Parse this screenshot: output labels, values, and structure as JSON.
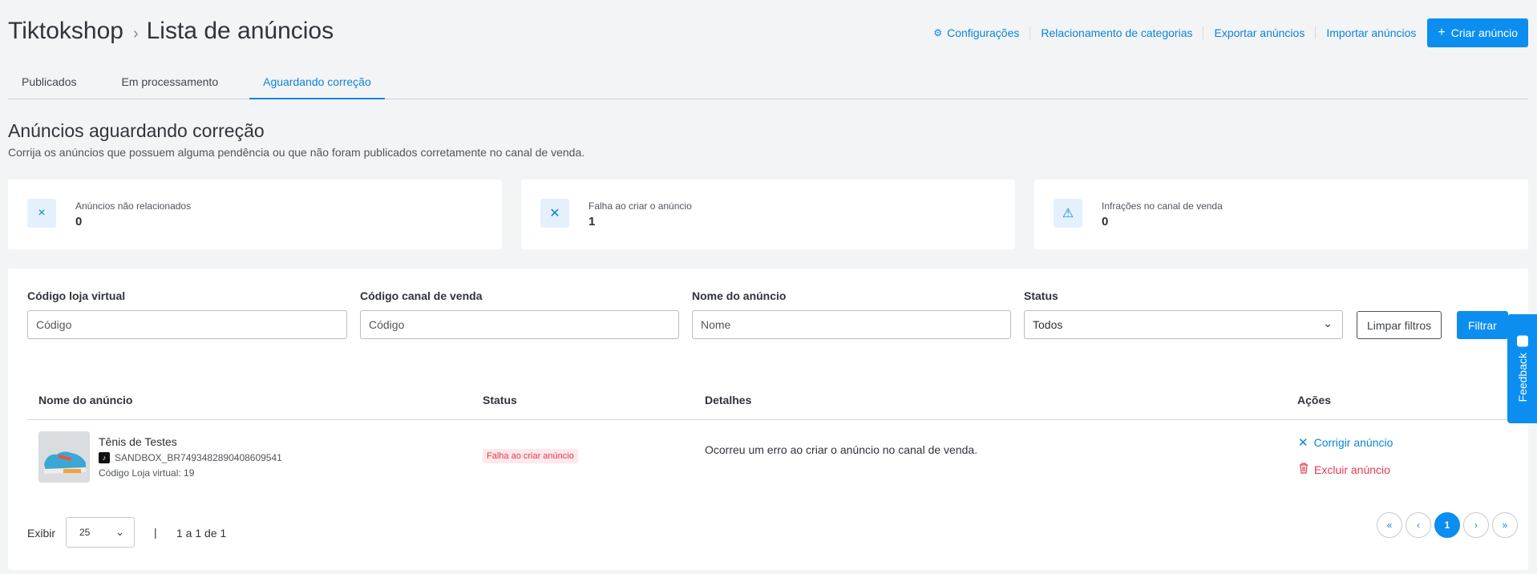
{
  "header": {
    "breadcrumb_root": "Tiktokshop",
    "breadcrumb_sep": "›",
    "page_title": "Lista de anúncios"
  },
  "toolbar": {
    "settings_icon": "⚙",
    "settings_label": "Configurações",
    "category_label": "Relacionamento de categorias",
    "export_label": "Exportar anúncios",
    "import_label": "Importar anúncios",
    "create_icon": "+",
    "create_label": "Criar anúncio"
  },
  "tabs": [
    {
      "label": "Publicados"
    },
    {
      "label": "Em processamento"
    },
    {
      "label": "Aguardando correção",
      "active": true
    }
  ],
  "section": {
    "title": "Anúncios aguardando correção",
    "subtitle": "Corrija os anúncios que possuem alguma pendência ou que não foram publicados corretamente no canal de venda."
  },
  "cards": [
    {
      "icon": "×",
      "label": "Anúncios não relacionados",
      "value": "0"
    },
    {
      "icon": "✕",
      "label": "Falha ao criar o anúncio",
      "value": "1"
    },
    {
      "icon": "⚠",
      "label": "Infrações no canal de venda",
      "value": "0"
    }
  ],
  "filters": {
    "code_label": "Código loja virtual",
    "code_placeholder": "Código",
    "channel_label": "Código canal de venda",
    "channel_placeholder": "Código",
    "name_label": "Nome do anúncio",
    "name_placeholder": "Nome",
    "status_label": "Status",
    "status_value": "Todos",
    "clear_label": "Limpar filtros",
    "filter_label": "Filtrar"
  },
  "table": {
    "headers": [
      "Nome do anúncio",
      "Status",
      "Detalhes",
      "Ações"
    ],
    "rows": [
      {
        "name": "Tênis de Testes",
        "sku": "SANDBOX_BR7493482890408609541",
        "store_code": "Código Loja virtual: 19",
        "status": "Falha ao criar anúncio",
        "detail": "Ocorreu um erro ao criar o anúncio no canal de venda.",
        "fix_label": "Corrigir anúncio",
        "delete_label": "Excluir anúncio"
      }
    ]
  },
  "pagination": {
    "show_label": "Exibir",
    "page_size": "25",
    "separator": "|",
    "range": "1 a 1 de 1",
    "first": "«",
    "prev": "‹",
    "current": "1",
    "next": "›",
    "last": "»"
  },
  "feedback": {
    "label": "Feedback"
  },
  "colors": {
    "primary": "#0b8ef0",
    "link": "#0b84d8",
    "danger": "#e23b4e",
    "background": "#f3f4f6"
  }
}
